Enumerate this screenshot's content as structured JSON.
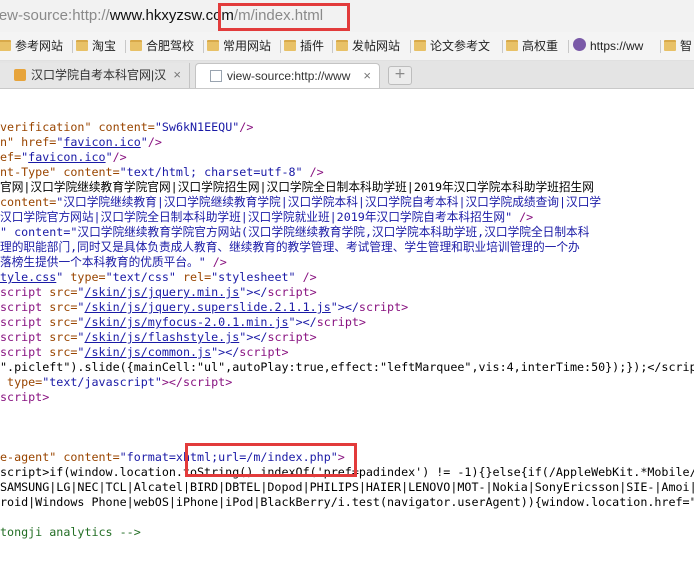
{
  "address_bar": {
    "url_prefix": "view-source:http://",
    "url_host": "www.hkxyzsw.com",
    "url_path": "/m/index.html"
  },
  "bookmarks": [
    {
      "label": "参考网站",
      "icon": "folder-icon"
    },
    {
      "label": "淘宝",
      "icon": "folder-icon"
    },
    {
      "label": "合肥驾校",
      "icon": "folder-icon"
    },
    {
      "label": "常用网站",
      "icon": "folder-icon"
    },
    {
      "label": "插件",
      "icon": "folder-icon"
    },
    {
      "label": "发帖网站",
      "icon": "folder-icon"
    },
    {
      "label": "论文参考文",
      "icon": "folder-icon"
    },
    {
      "label": "高权重",
      "icon": "folder-icon"
    },
    {
      "label": "https://ww",
      "icon": "globe-icon"
    },
    {
      "label": "智",
      "icon": "folder-icon"
    }
  ],
  "tabs": [
    {
      "label": "汉口学院自考本科官网|汉",
      "close": "×",
      "active": false
    },
    {
      "label": "view-source:http://www",
      "close": "×",
      "active": true
    }
  ],
  "new_tab": "+",
  "source": {
    "l1": {
      "a1": "verification\"",
      "a2": " content=",
      "v1": "\"Sw6kN1EEQU\"",
      "t1": "/>"
    },
    "l2": {
      "a1": "n\"",
      "a2": " href=",
      "q1": "\"",
      "lk": "favicon.ico",
      "q2": "\"",
      "t1": "/>"
    },
    "l3": {
      "a1": "ef=",
      "q1": "\"",
      "lk": "favicon.ico",
      "q2": "\"",
      "t1": "/>"
    },
    "l4": {
      "a1": "nt-Type\"",
      "a2": " content=",
      "v1": "\"text/html; charset=utf-8\"",
      "t1": " />"
    },
    "l5": "官网|汉口学院继续教育学院官网|汉口学院招生网|汉口学院全日制本科助学班|2019年汉口学院本科助学班招生网",
    "l6": {
      "a1": "content=",
      "v1": "\"汉口学院继续教育|汉口学院继续教育学院|汉口学院本科|汉口学院自考本科|汉口学院成绩查询|汉口学"
    },
    "l7": {
      "v1": "汉口学院官方网站|汉口学院全日制本科助学班|汉口学院就业班|2019年汉口学院自考本科招生网\"",
      "t1": " />"
    },
    "l8": {
      "v1": "\" content=\"汉口学院继续教育学院官方网站(汉口学院继续教育学院,汉口学院本科助学班,汉口学院全日制本科"
    },
    "l9": "理的职能部门,同时又是具体负责成人教育、继续教育的教学管理、考试管理、学生管理和职业培训管理的一个办",
    "l10": {
      "v1": "落榜生提供一个本科教育的优质平台。\"",
      "t1": " />"
    },
    "l11": {
      "lk": "tyle.css",
      "v1": "\"",
      "a1": " type=",
      "v2": "\"text/css\"",
      "a2": " rel=",
      "v3": "\"stylesheet\"",
      "t1": " />"
    },
    "scripts": [
      {
        "t0": "script",
        "src": "/skin/js/jquery.min.js"
      },
      {
        "t0": "script",
        "src": "/skin/js/jquery.superslide.2.1.1.js"
      },
      {
        "t0": "script",
        "src": "/skin/js/myfocus-2.0.1.min.js"
      },
      {
        "t0": "script",
        "src": "/skin/js/flashstyle.js"
      },
      {
        "t0": "script",
        "src": "/skin/js/common.js"
      }
    ],
    "script_attr": " src=",
    "script_q": "\"",
    "script_end": "\"></",
    "script_close": "script>",
    "l17": "\".picleft\").slide({mainCell:\"ul\",autoPlay:true,effect:\"leftMarquee\",vis:4,interTime:50});});</script",
    "l18": {
      "a1": " type=",
      "v1": "\"text/javascript\"",
      "t1": "></",
      "t2": "script>"
    },
    "l19": {
      "t1": "script>"
    },
    "l23": {
      "a1": "e-agent\"",
      "a2": " content=",
      "v1": "\"format=xhtml;url=/m/index.php\"",
      "t1": ">"
    },
    "l24": "script>if(window.location.toString().indexOf('pref=padindex') != -1){}else{if(/AppleWebKit.*Mobile/",
    "l25": "SAMSUNG|LG|NEC|TCL|Alcatel|BIRD|DBTEL|Dopod|PHILIPS|HAIER|LENOVO|MOT-|Nokia|SonyEricsson|SIE-|Amoi|",
    "l26": "roid|Windows Phone|webOS|iPhone|iPod|BlackBerry/i.test(navigator.userAgent)){window.location.href=\"/",
    "l28": "tongji analytics -->"
  }
}
